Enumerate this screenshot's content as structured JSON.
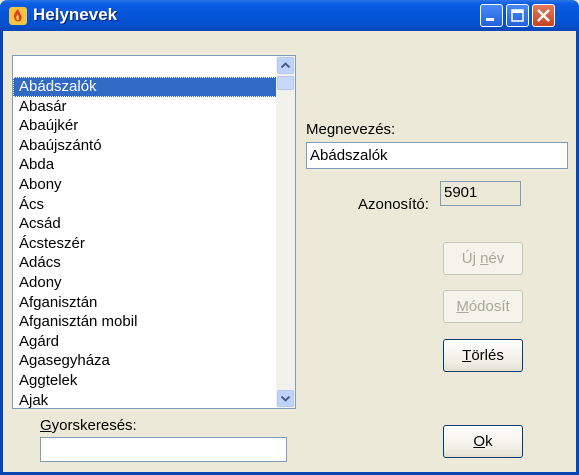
{
  "window": {
    "title": "Helynevek",
    "controls": {
      "minimize": "minimize",
      "maximize": "maximize",
      "close": "close"
    }
  },
  "list": {
    "selected_index": 0,
    "items": [
      "Abádszalók",
      "Abasár",
      "Abaújkér",
      "Abaújszántó",
      "Abda",
      "Abony",
      "Ács",
      "Acsád",
      "Ácsteszér",
      "Adács",
      "Adony",
      "Afganisztán",
      "Afganisztán mobil",
      "Agárd",
      "Agasegyháza",
      "Aggtelek",
      "Ajak"
    ]
  },
  "details": {
    "name_label": "Megnevezés:",
    "name_value": "Abádszalók",
    "id_label": "Azonosító:",
    "id_value": "5901"
  },
  "buttons": {
    "new": {
      "pre": "Új ",
      "mn": "n",
      "post": "év",
      "enabled": false
    },
    "modify": {
      "pre": "",
      "mn": "M",
      "post": "ódosít",
      "enabled": false
    },
    "delete": {
      "pre": "",
      "mn": "T",
      "post": "örlés",
      "enabled": true
    },
    "ok": {
      "pre": "",
      "mn": "O",
      "post": "k",
      "enabled": true
    }
  },
  "quicksearch": {
    "label_mn": "G",
    "label_rest": "yorskeresés:",
    "value": ""
  },
  "colors": {
    "titlebar": "#0655d8",
    "selection": "#316ac5",
    "dialog_bg": "#ece9d8"
  }
}
